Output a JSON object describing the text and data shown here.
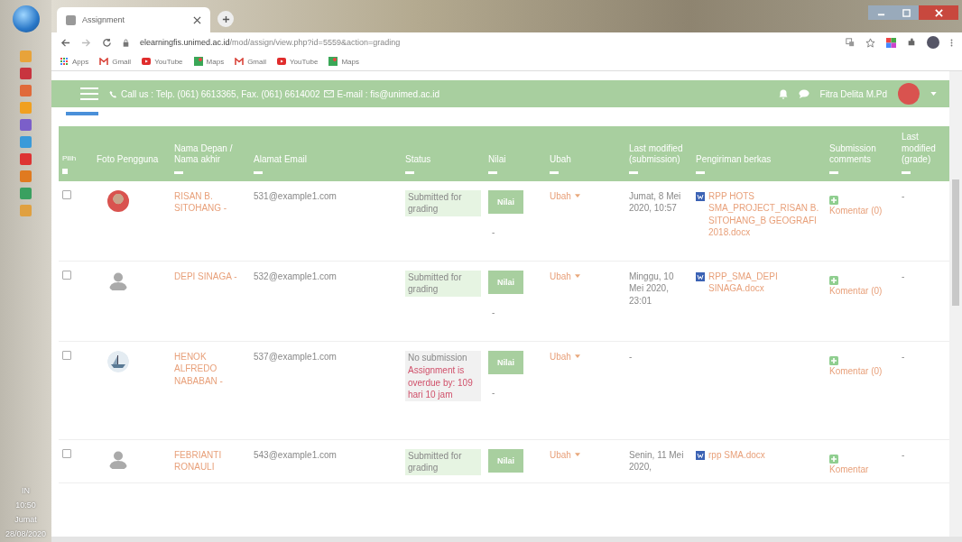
{
  "taskbar": {
    "language": "IN",
    "time": "10:50",
    "day": "Jumat",
    "date": "28/08/2020"
  },
  "browser": {
    "tab_title": "Assignment",
    "url_host": "elearningfis.unimed.ac.id",
    "url_path": "/mod/assign/view.php?id=5559&action=grading",
    "bookmarks": [
      {
        "kind": "apps",
        "label": "Apps"
      },
      {
        "kind": "gmail",
        "label": "Gmail"
      },
      {
        "kind": "youtube",
        "label": "YouTube"
      },
      {
        "kind": "maps",
        "label": "Maps"
      },
      {
        "kind": "gmail",
        "label": "Gmail"
      },
      {
        "kind": "youtube",
        "label": "YouTube"
      },
      {
        "kind": "maps",
        "label": "Maps"
      }
    ]
  },
  "header": {
    "phone": "Call us : Telp. (061) 6613365, Fax. (061) 6614002",
    "email": "E-mail : fis@unimed.ac.id",
    "user_name": "Fitra Delita M.Pd"
  },
  "table": {
    "columns": [
      {
        "label": "Pilih",
        "kind": "select",
        "checked": false
      },
      {
        "label": "Foto Pengguna",
        "kind": "plain"
      },
      {
        "label": "Nama Depan / Nama akhir",
        "kind": "hide"
      },
      {
        "label": "Alamat Email",
        "kind": "hide"
      },
      {
        "label": "Status",
        "kind": "hide"
      },
      {
        "label": "Nilai",
        "kind": "hide"
      },
      {
        "label": "Ubah",
        "kind": "hide"
      },
      {
        "label": "Last modified (submission)",
        "kind": "hide"
      },
      {
        "label": "Pengiriman berkas",
        "kind": "hide"
      },
      {
        "label": "Submission comments",
        "kind": "hide"
      },
      {
        "label": "Last modified (grade)",
        "kind": "hide"
      }
    ],
    "rows": [
      {
        "checked": false,
        "avatar": {
          "kind": "photo"
        },
        "name": "RISAN B. SITOHANG -",
        "email": "531@example1.com",
        "status": {
          "kind": "submitted",
          "text": "Submitted for grading"
        },
        "grade_button": "Nilai",
        "grade": "-",
        "edit": "Ubah",
        "modified": "Jumat, 8 Mei 2020, 10:57",
        "file": "RPP HOTS SMA_PROJECT_RISAN B. SITOHANG_B GEOGRAFI 2018.docx",
        "comment": "Komentar (0)",
        "grade_modified": "-"
      },
      {
        "checked": false,
        "avatar": {
          "kind": "default"
        },
        "name": "DEPI SINAGA -",
        "email": "532@example1.com",
        "status": {
          "kind": "submitted",
          "text": "Submitted for grading"
        },
        "grade_button": "Nilai",
        "grade": "-",
        "edit": "Ubah",
        "modified": "Minggu, 10 Mei 2020, 23:01",
        "file": "RPP_SMA_DEPI SINAGA.docx",
        "comment": "Komentar (0)",
        "grade_modified": "-"
      },
      {
        "checked": false,
        "avatar": {
          "kind": "picture"
        },
        "name": "HENOK ALFREDO NABABAN -",
        "email": "537@example1.com",
        "status": {
          "kind": "none",
          "text": "No submission"
        },
        "overdue": "Assignment is overdue by: 109 hari 10 jam",
        "grade_button": "Nilai",
        "grade": "-",
        "edit": "Ubah",
        "modified": "-",
        "comment": "Komentar (0)",
        "grade_modified": "-"
      },
      {
        "checked": false,
        "avatar": {
          "kind": "default"
        },
        "name": "FEBRIANTI RONAULI",
        "email": "543@example1.com",
        "status": {
          "kind": "submitted",
          "text": "Submitted for grading"
        },
        "grade_button": "Nilai",
        "edit": "Ubah",
        "modified": "Senin, 11 Mei 2020,",
        "file": "rpp SMA.docx",
        "comment": "Komentar",
        "grade_modified": "-"
      }
    ]
  }
}
